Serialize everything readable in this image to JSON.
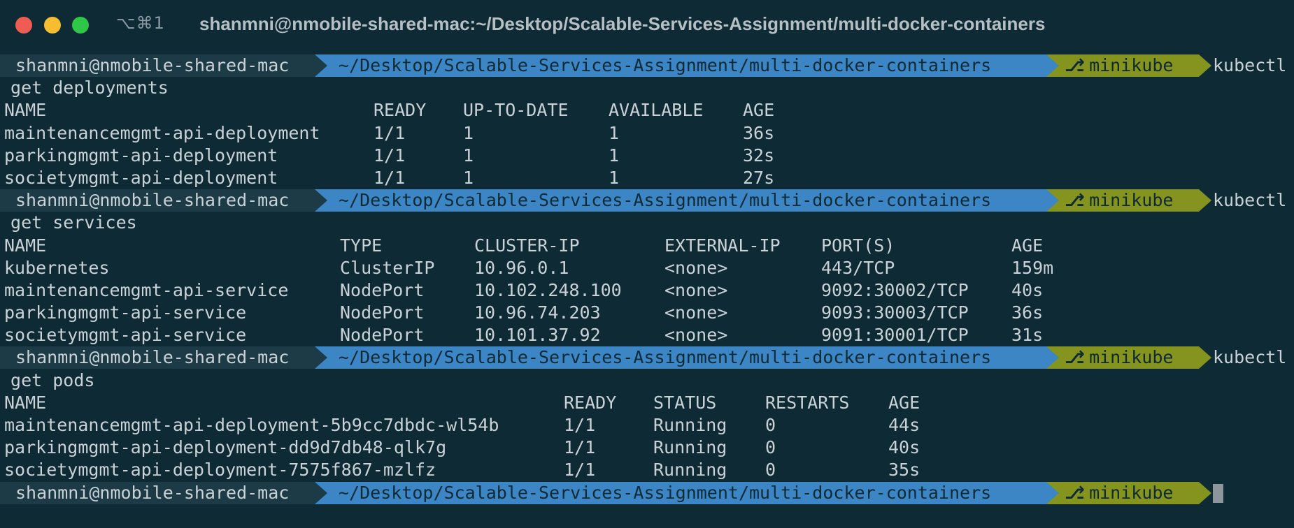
{
  "window": {
    "shortcut": "⌥⌘1",
    "title": "shanmni@nmobile-shared-mac:~/Desktop/Scalable-Services-Assignment/multi-docker-containers"
  },
  "prompt": {
    "user_host": "shanmni@nmobile-shared-mac",
    "path": "~/Desktop/Scalable-Services-Assignment/multi-docker-containers",
    "branch_icon": "branch-icon",
    "branch": "minikube"
  },
  "commands": [
    {
      "head": "kubectl",
      "tail": " get deployments"
    },
    {
      "head": "kubectl",
      "tail": " get services"
    },
    {
      "head": "kubectl",
      "tail": " get pods"
    }
  ],
  "deployments": {
    "headers": [
      "NAME",
      "READY",
      "UP-TO-DATE",
      "AVAILABLE",
      "AGE"
    ],
    "rows": [
      [
        "maintenancemgmt-api-deployment",
        "1/1",
        "1",
        "1",
        "36s"
      ],
      [
        "parkingmgmt-api-deployment",
        "1/1",
        "1",
        "1",
        "32s"
      ],
      [
        "societymgmt-api-deployment",
        "1/1",
        "1",
        "1",
        "27s"
      ]
    ]
  },
  "services": {
    "headers": [
      "NAME",
      "TYPE",
      "CLUSTER-IP",
      "EXTERNAL-IP",
      "PORT(S)",
      "AGE"
    ],
    "rows": [
      [
        "kubernetes",
        "ClusterIP",
        "10.96.0.1",
        "<none>",
        "443/TCP",
        "159m"
      ],
      [
        "maintenancemgmt-api-service",
        "NodePort",
        "10.102.248.100",
        "<none>",
        "9092:30002/TCP",
        "40s"
      ],
      [
        "parkingmgmt-api-service",
        "NodePort",
        "10.96.74.203",
        "<none>",
        "9093:30003/TCP",
        "36s"
      ],
      [
        "societymgmt-api-service",
        "NodePort",
        "10.101.37.92",
        "<none>",
        "9091:30001/TCP",
        "31s"
      ]
    ]
  },
  "pods": {
    "headers": [
      "NAME",
      "READY",
      "STATUS",
      "RESTARTS",
      "AGE"
    ],
    "rows": [
      [
        "maintenancemgmt-api-deployment-5b9cc7dbdc-wl54b",
        "1/1",
        "Running",
        "0",
        "44s"
      ],
      [
        "parkingmgmt-api-deployment-dd9d7db48-qlk7g",
        "1/1",
        "Running",
        "0",
        "40s"
      ],
      [
        "societymgmt-api-deployment-7575f867-mzlfz",
        "1/1",
        "Running",
        "0",
        "35s"
      ]
    ]
  },
  "colors": {
    "background": "#0e2a35",
    "user_segment": "#1d3b47",
    "path_segment": "#3d86c6",
    "git_segment": "#85931f",
    "text": "#c9d2d6"
  }
}
